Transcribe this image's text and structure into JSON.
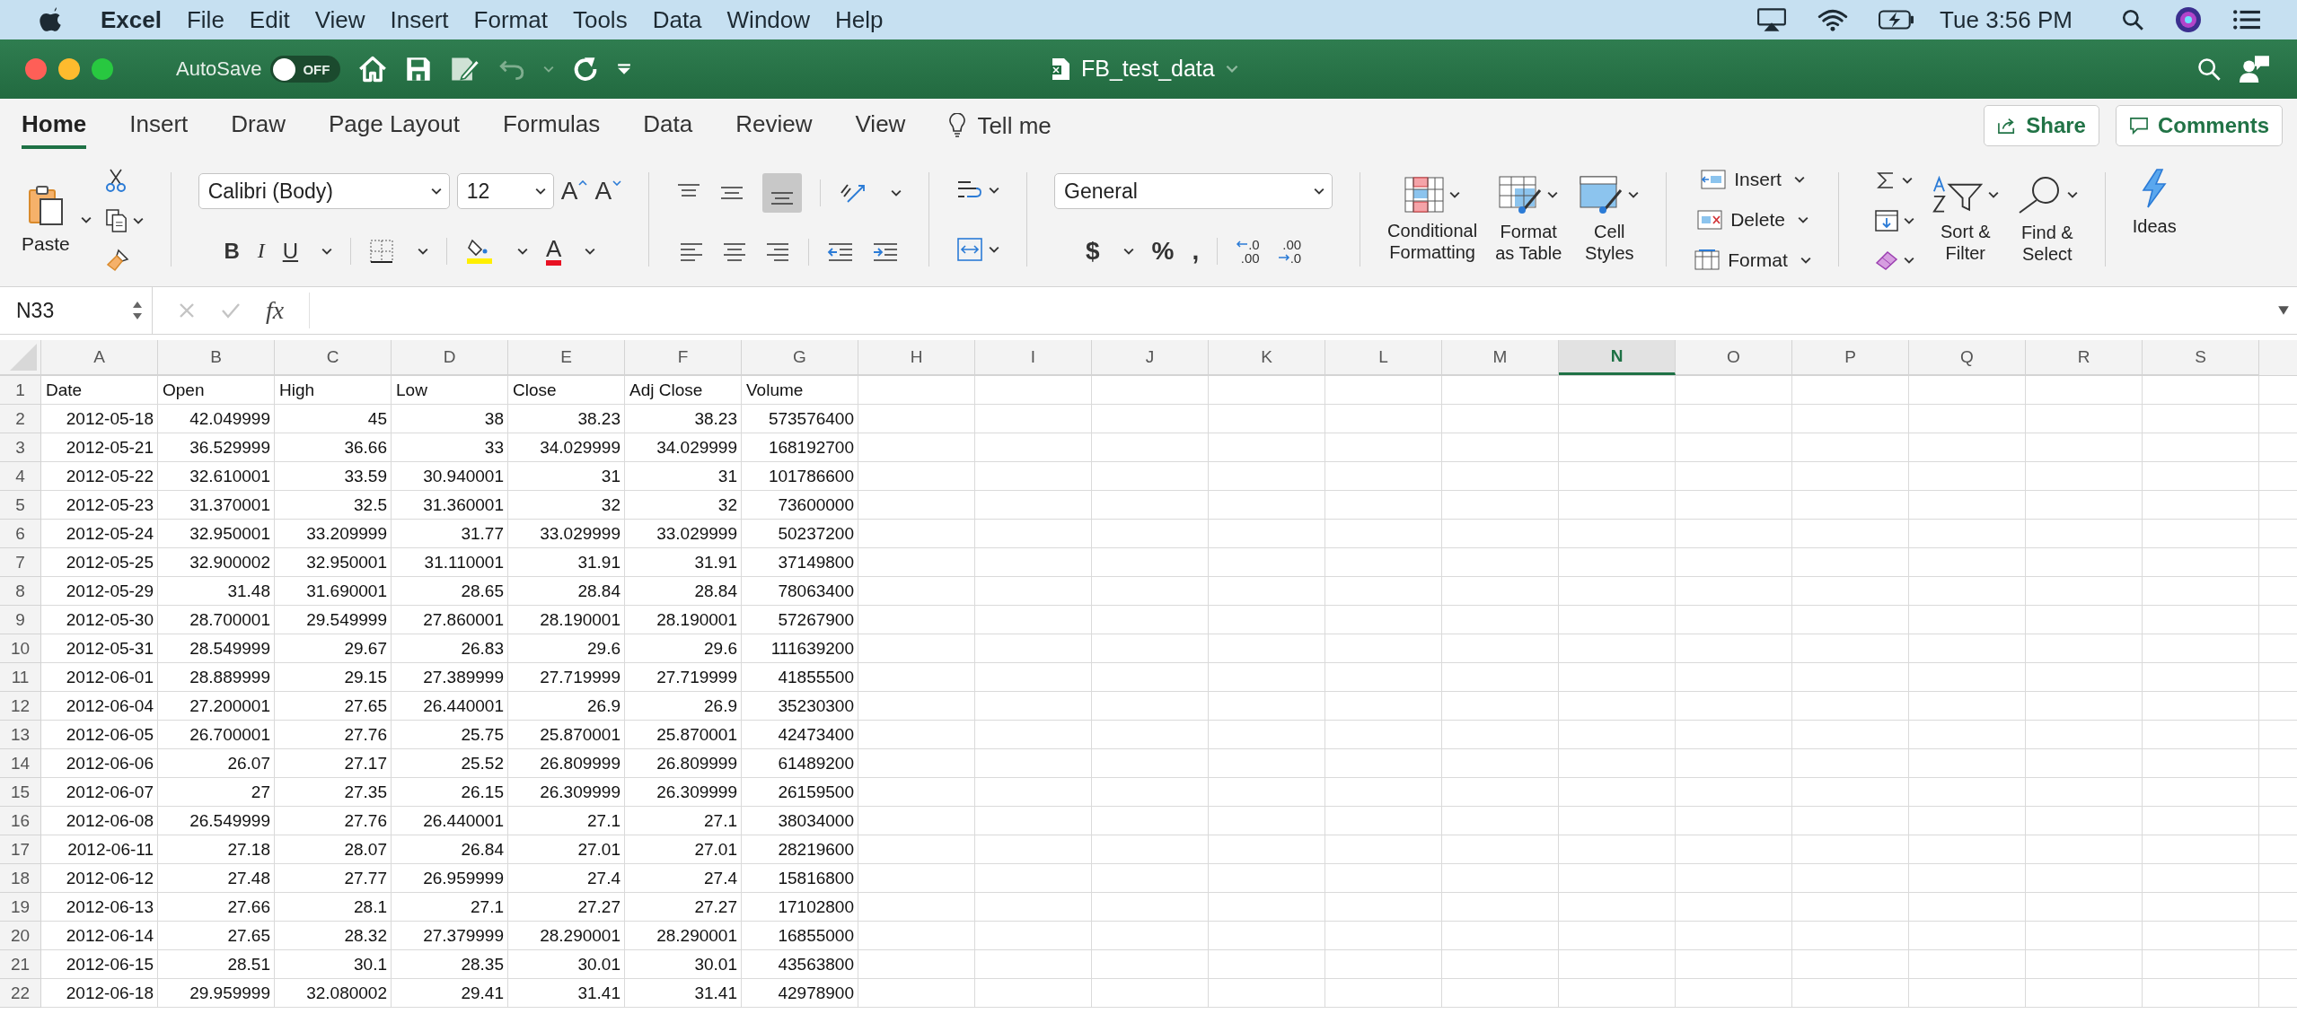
{
  "menubar": {
    "app": "Excel",
    "items": [
      "File",
      "Edit",
      "View",
      "Insert",
      "Format",
      "Tools",
      "Data",
      "Window",
      "Help"
    ],
    "clock": "Tue 3:56 PM"
  },
  "titlebar": {
    "autosave_label": "AutoSave",
    "autosave": {
      "on": false,
      "text": "OFF"
    },
    "document": "FB_test_data"
  },
  "ribbon_tabs": [
    {
      "label": "Home",
      "selected": true
    },
    {
      "label": "Insert",
      "selected": false
    },
    {
      "label": "Draw",
      "selected": false
    },
    {
      "label": "Page Layout",
      "selected": false
    },
    {
      "label": "Formulas",
      "selected": false
    },
    {
      "label": "Data",
      "selected": false
    },
    {
      "label": "Review",
      "selected": false
    },
    {
      "label": "View",
      "selected": false
    }
  ],
  "tell_me": "Tell me",
  "share_button": "Share",
  "comments_button": "Comments",
  "ribbon": {
    "paste": "Paste",
    "font": {
      "family": "Calibri (Body)",
      "size": "12",
      "size_buttons": [
        {
          "label": "A",
          "kind": "grow"
        },
        {
          "label": "A",
          "kind": "shrink"
        }
      ],
      "style_buttons": [
        {
          "label": "B",
          "kind": "bold"
        },
        {
          "label": "I",
          "kind": "italic"
        },
        {
          "label": "U",
          "kind": "underline"
        }
      ],
      "font_color_label": "A"
    },
    "number": {
      "format": "General",
      "buttons": [
        {
          "label": "$",
          "caret": true
        },
        {
          "label": "%",
          "caret": false
        },
        {
          "label": ",",
          "caret": false
        }
      ],
      "decimals": [
        {
          "kind": "increase",
          "lines": [
            ".0",
            ".00"
          ]
        },
        {
          "kind": "decrease",
          "lines": [
            ".00",
            ".0"
          ]
        }
      ]
    },
    "styles": [
      {
        "kind": "conditional",
        "lines": [
          "Conditional",
          "Formatting"
        ]
      },
      {
        "kind": "table",
        "lines": [
          "Format",
          "as Table"
        ]
      },
      {
        "kind": "cell",
        "lines": [
          "Cell",
          "Styles"
        ]
      }
    ],
    "cells": [
      {
        "kind": "insert",
        "label": "Insert"
      },
      {
        "kind": "delete",
        "label": "Delete"
      },
      {
        "kind": "format",
        "label": "Format"
      }
    ],
    "editing": [
      {
        "kind": "sort",
        "lines": [
          "Sort &",
          "Filter"
        ]
      },
      {
        "kind": "find",
        "lines": [
          "Find &",
          "Select"
        ]
      }
    ],
    "ideas": "Ideas"
  },
  "formula_bar": {
    "name_box": "N33",
    "fx": "fx"
  },
  "sheet": {
    "columns": [
      {
        "letter": "A",
        "selected": false
      },
      {
        "letter": "B",
        "selected": false
      },
      {
        "letter": "C",
        "selected": false
      },
      {
        "letter": "D",
        "selected": false
      },
      {
        "letter": "E",
        "selected": false
      },
      {
        "letter": "F",
        "selected": false
      },
      {
        "letter": "G",
        "selected": false
      },
      {
        "letter": "H",
        "selected": false
      },
      {
        "letter": "I",
        "selected": false
      },
      {
        "letter": "J",
        "selected": false
      },
      {
        "letter": "K",
        "selected": false
      },
      {
        "letter": "L",
        "selected": false
      },
      {
        "letter": "M",
        "selected": false
      },
      {
        "letter": "N",
        "selected": true
      },
      {
        "letter": "O",
        "selected": false
      },
      {
        "letter": "P",
        "selected": false
      },
      {
        "letter": "Q",
        "selected": false
      },
      {
        "letter": "R",
        "selected": false
      },
      {
        "letter": "S",
        "selected": false
      }
    ],
    "rows": [
      {
        "number": "1",
        "kind": "text",
        "cells": [
          "Date",
          "Open",
          "High",
          "Low",
          "Close",
          "Adj Close",
          "Volume"
        ]
      },
      {
        "number": "2",
        "kind": "number",
        "cells": [
          "2012-05-18",
          "42.049999",
          "45",
          "38",
          "38.23",
          "38.23",
          "573576400"
        ]
      },
      {
        "number": "3",
        "kind": "number",
        "cells": [
          "2012-05-21",
          "36.529999",
          "36.66",
          "33",
          "34.029999",
          "34.029999",
          "168192700"
        ]
      },
      {
        "number": "4",
        "kind": "number",
        "cells": [
          "2012-05-22",
          "32.610001",
          "33.59",
          "30.940001",
          "31",
          "31",
          "101786600"
        ]
      },
      {
        "number": "5",
        "kind": "number",
        "cells": [
          "2012-05-23",
          "31.370001",
          "32.5",
          "31.360001",
          "32",
          "32",
          "73600000"
        ]
      },
      {
        "number": "6",
        "kind": "number",
        "cells": [
          "2012-05-24",
          "32.950001",
          "33.209999",
          "31.77",
          "33.029999",
          "33.029999",
          "50237200"
        ]
      },
      {
        "number": "7",
        "kind": "number",
        "cells": [
          "2012-05-25",
          "32.900002",
          "32.950001",
          "31.110001",
          "31.91",
          "31.91",
          "37149800"
        ]
      },
      {
        "number": "8",
        "kind": "number",
        "cells": [
          "2012-05-29",
          "31.48",
          "31.690001",
          "28.65",
          "28.84",
          "28.84",
          "78063400"
        ]
      },
      {
        "number": "9",
        "kind": "number",
        "cells": [
          "2012-05-30",
          "28.700001",
          "29.549999",
          "27.860001",
          "28.190001",
          "28.190001",
          "57267900"
        ]
      },
      {
        "number": "10",
        "kind": "number",
        "cells": [
          "2012-05-31",
          "28.549999",
          "29.67",
          "26.83",
          "29.6",
          "29.6",
          "111639200"
        ]
      },
      {
        "number": "11",
        "kind": "number",
        "cells": [
          "2012-06-01",
          "28.889999",
          "29.15",
          "27.389999",
          "27.719999",
          "27.719999",
          "41855500"
        ]
      },
      {
        "number": "12",
        "kind": "number",
        "cells": [
          "2012-06-04",
          "27.200001",
          "27.65",
          "26.440001",
          "26.9",
          "26.9",
          "35230300"
        ]
      },
      {
        "number": "13",
        "kind": "number",
        "cells": [
          "2012-06-05",
          "26.700001",
          "27.76",
          "25.75",
          "25.870001",
          "25.870001",
          "42473400"
        ]
      },
      {
        "number": "14",
        "kind": "number",
        "cells": [
          "2012-06-06",
          "26.07",
          "27.17",
          "25.52",
          "26.809999",
          "26.809999",
          "61489200"
        ]
      },
      {
        "number": "15",
        "kind": "number",
        "cells": [
          "2012-06-07",
          "27",
          "27.35",
          "26.15",
          "26.309999",
          "26.309999",
          "26159500"
        ]
      },
      {
        "number": "16",
        "kind": "number",
        "cells": [
          "2012-06-08",
          "26.549999",
          "27.76",
          "26.440001",
          "27.1",
          "27.1",
          "38034000"
        ]
      },
      {
        "number": "17",
        "kind": "number",
        "cells": [
          "2012-06-11",
          "27.18",
          "28.07",
          "26.84",
          "27.01",
          "27.01",
          "28219600"
        ]
      },
      {
        "number": "18",
        "kind": "number",
        "cells": [
          "2012-06-12",
          "27.48",
          "27.77",
          "26.959999",
          "27.4",
          "27.4",
          "15816800"
        ]
      },
      {
        "number": "19",
        "kind": "number",
        "cells": [
          "2012-06-13",
          "27.66",
          "28.1",
          "27.1",
          "27.27",
          "27.27",
          "17102800"
        ]
      },
      {
        "number": "20",
        "kind": "number",
        "cells": [
          "2012-06-14",
          "27.65",
          "28.32",
          "27.379999",
          "28.290001",
          "28.290001",
          "16855000"
        ]
      },
      {
        "number": "21",
        "kind": "number",
        "cells": [
          "2012-06-15",
          "28.51",
          "30.1",
          "28.35",
          "30.01",
          "30.01",
          "43563800"
        ]
      },
      {
        "number": "22",
        "kind": "number",
        "cells": [
          "2012-06-18",
          "29.959999",
          "32.080002",
          "29.41",
          "31.41",
          "31.41",
          "42978900"
        ]
      }
    ]
  }
}
